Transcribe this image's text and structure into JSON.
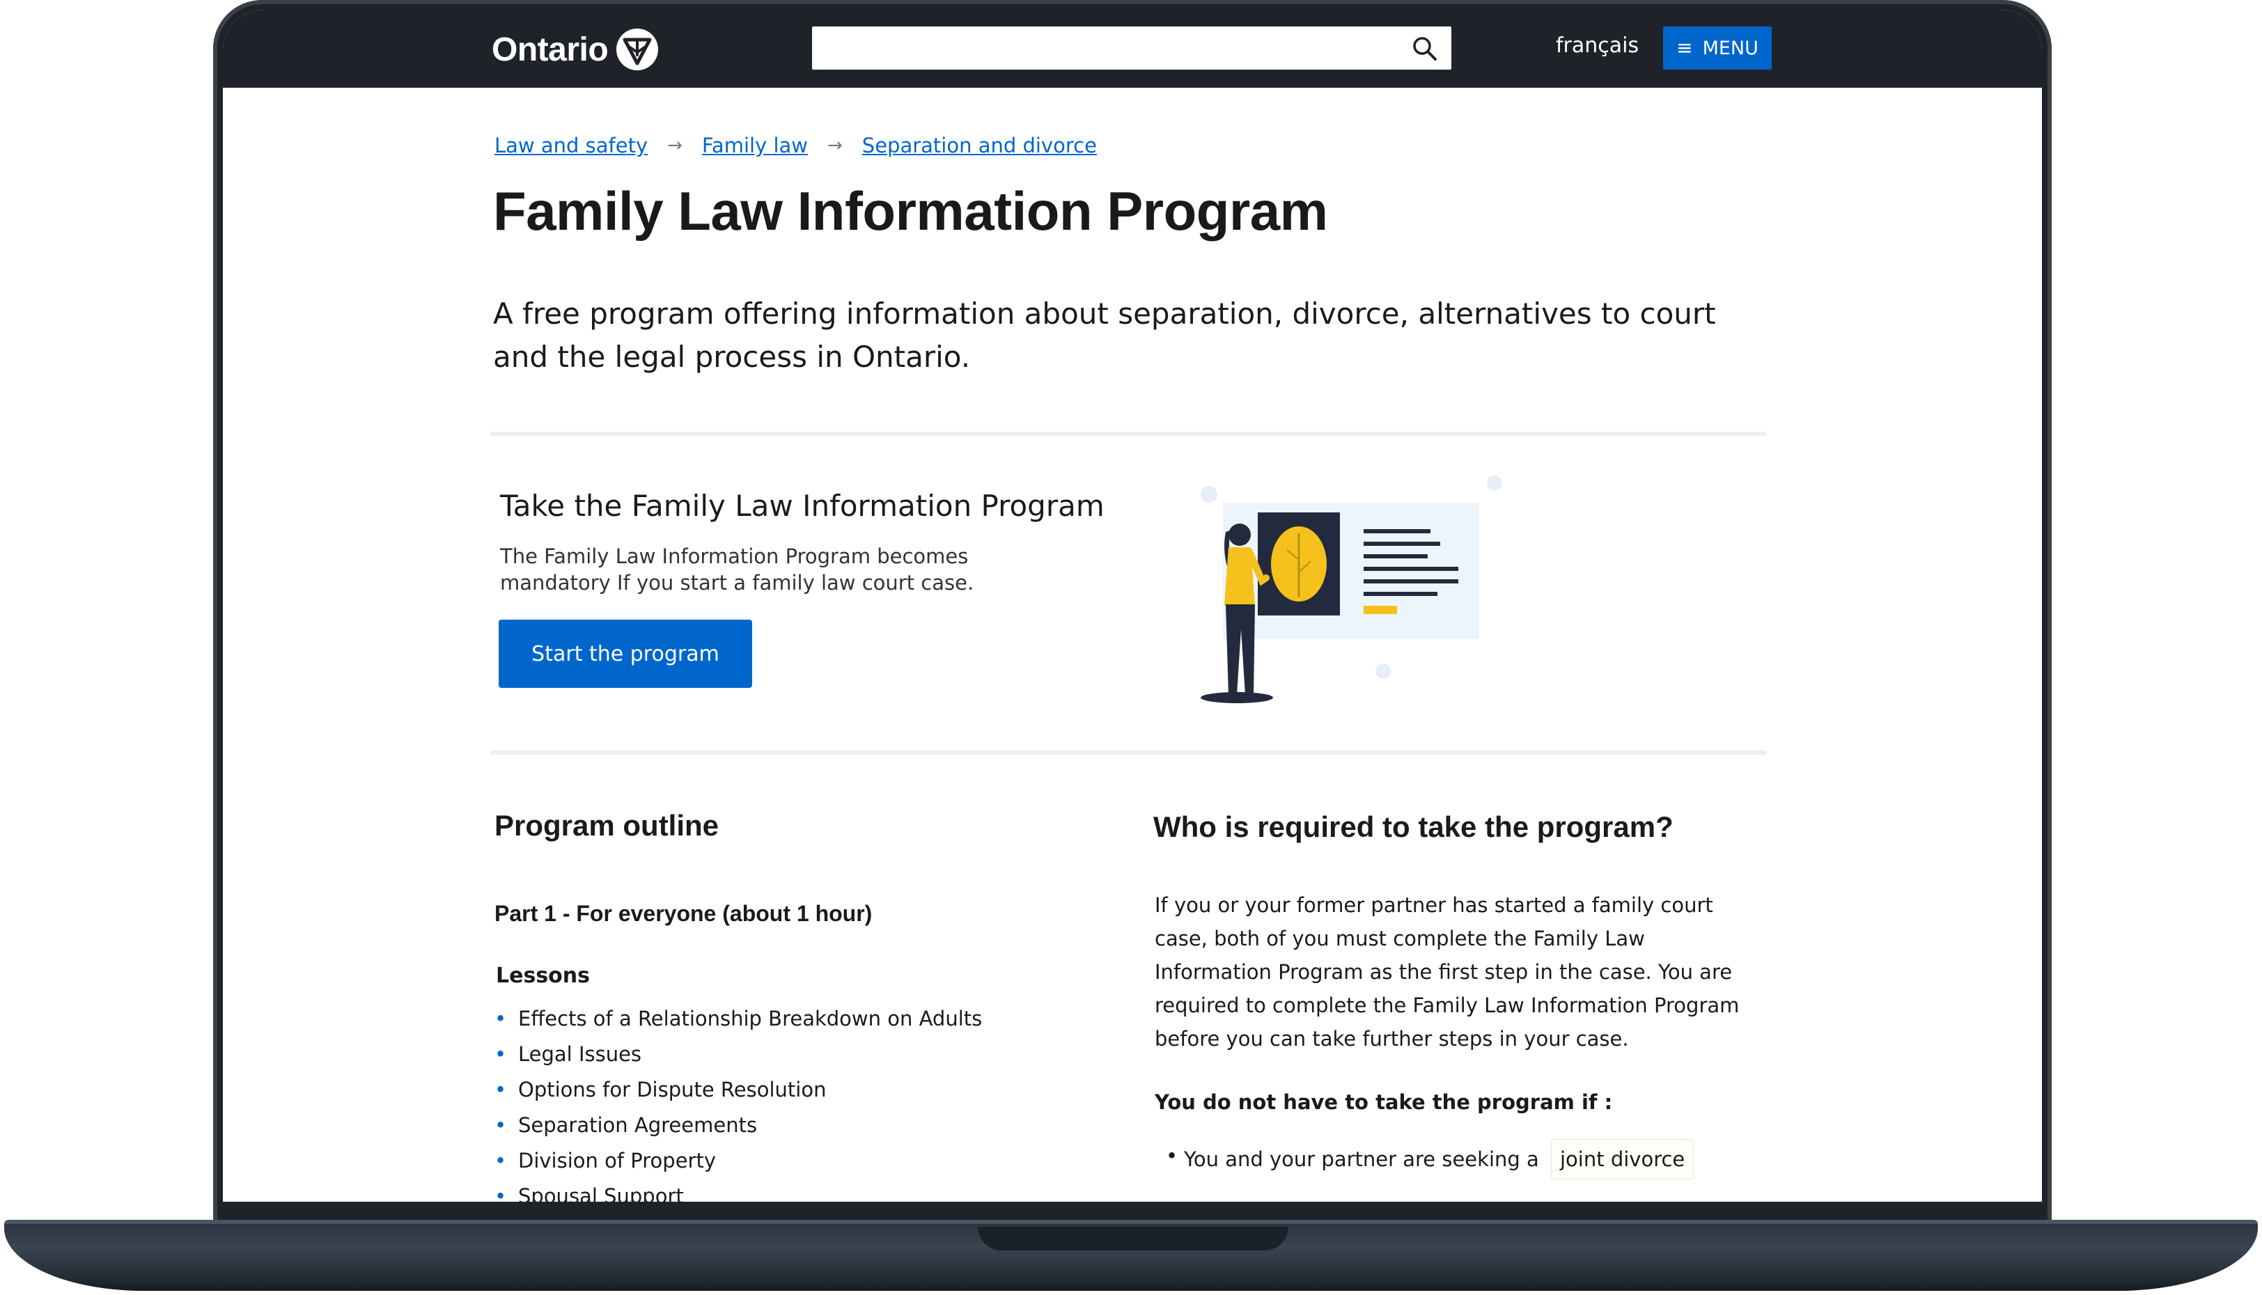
{
  "header": {
    "logo_text": "Ontario",
    "search": {
      "value": "",
      "placeholder": ""
    },
    "language_link": "français",
    "menu_label": "MENU"
  },
  "breadcrumbs": [
    {
      "label": "Law and safety"
    },
    {
      "label": "Family law"
    },
    {
      "label": "Separation and divorce"
    }
  ],
  "breadcrumb_separator": "→",
  "page": {
    "title": "Family Law Information Program",
    "lead": "A free program offering information about separation, divorce, alternatives to court and the legal process in Ontario."
  },
  "cta": {
    "title": "Take the Family Law Information Program",
    "text": "The Family Law Information Program becomes mandatory If you start a family law court case.",
    "button_label": "Start the program"
  },
  "outline": {
    "title": "Program outline",
    "part_title": "Part 1 - For everyone (about 1 hour)",
    "lessons_title": "Lessons",
    "lessons": [
      "Effects of a Relationship Breakdown on Adults",
      "Legal Issues",
      "Options for Dispute Resolution",
      "Separation Agreements",
      "Division of Property",
      "Spousal Support"
    ]
  },
  "who": {
    "title": "Who is required to take the program?",
    "text": "If you or your former partner has started a family court case, both of you must complete the Family Law Information Program as the first step in the case. You are required to complete the Family Law Information Program before you can take further steps in your case.",
    "not_required_title": "You do not have to take the program if :",
    "exemptions": [
      {
        "text": "You and your partner are seeking a",
        "tag": "joint divorce"
      }
    ]
  },
  "colors": {
    "header_bg": "#1f2329",
    "accent_blue": "#0066cc",
    "illustration_yellow": "#f5c11d",
    "illustration_navy": "#232a3d"
  },
  "icons": [
    "ontario-trillium-logo-icon",
    "search-icon",
    "hamburger-menu-icon"
  ]
}
